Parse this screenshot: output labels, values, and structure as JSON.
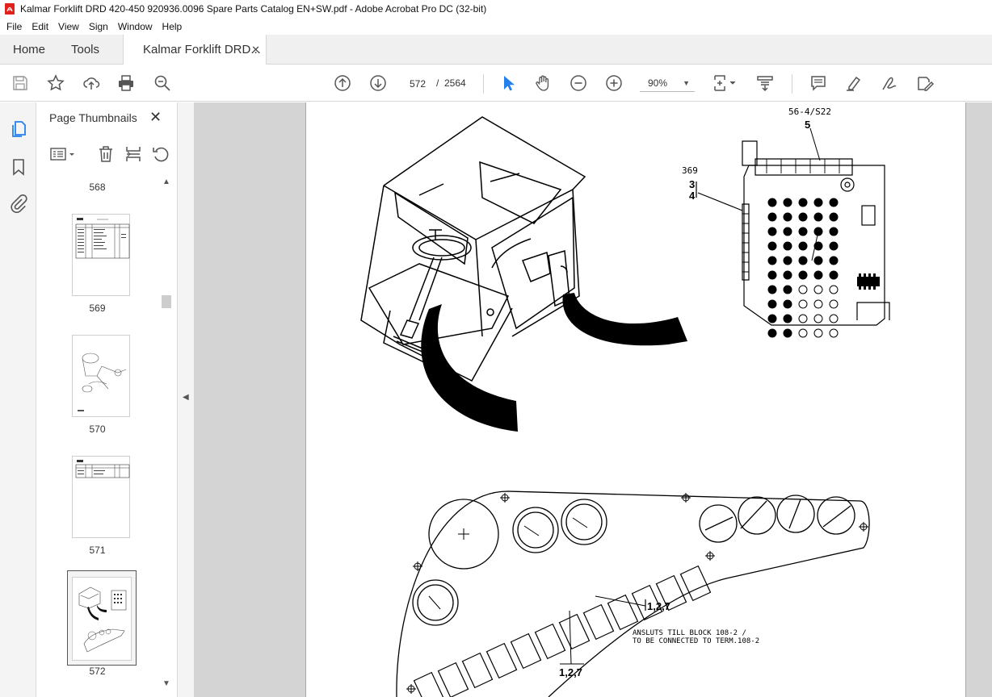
{
  "window": {
    "title": "Kalmar Forklift DRD 420-450 920936.0096 Spare Parts Catalog EN+SW.pdf - Adobe Acrobat Pro DC (32-bit)"
  },
  "menu": {
    "items": [
      "File",
      "Edit",
      "View",
      "Sign",
      "Window",
      "Help"
    ]
  },
  "tabs": {
    "home": "Home",
    "tools": "Tools",
    "document": "Kalmar Forklift DRD...",
    "close_glyph": "✕"
  },
  "toolbar": {
    "current_page": "572",
    "page_separator": "/",
    "total_pages": "2564",
    "zoom": "90%",
    "icons": [
      "save-icon",
      "bookmark-star-icon",
      "upload-icon",
      "print-icon",
      "zoom-search-icon",
      "page-up-icon",
      "page-down-icon",
      "select-arrow-icon",
      "hand-icon",
      "zoom-out-icon",
      "zoom-in-icon",
      "fit-page-icon",
      "scroll-mode-icon",
      "comment-icon",
      "highlight-icon",
      "sign-icon",
      "edit-pdf-icon"
    ]
  },
  "left_rail": {
    "icons": [
      "pages-icon",
      "bookmark-icon",
      "attachment-icon"
    ]
  },
  "thumbnail_panel": {
    "title": "Page Thumbnails",
    "close_glyph": "✕",
    "pages": [
      "568",
      "569",
      "570",
      "571",
      "572"
    ],
    "selected_page": "572"
  },
  "document_page": {
    "labels": {
      "top_ref": "56-4/S22",
      "top_ref_item": "5",
      "side_ref": "369",
      "side_item_a": "3",
      "side_item_b": "4",
      "callout_1": "1,2,7",
      "callout_2": "1,2,7",
      "note_line_1": "ANSLUTS TILL BLOCK 108-2 /",
      "note_line_2": "TO BE CONNECTED TO TERM.108-2"
    }
  },
  "colors": {
    "accent": "#2680eb",
    "viewer_bg": "#d4d4d4",
    "panel_bg": "#f4f4f4",
    "tab_bg": "#f0f0f0"
  }
}
